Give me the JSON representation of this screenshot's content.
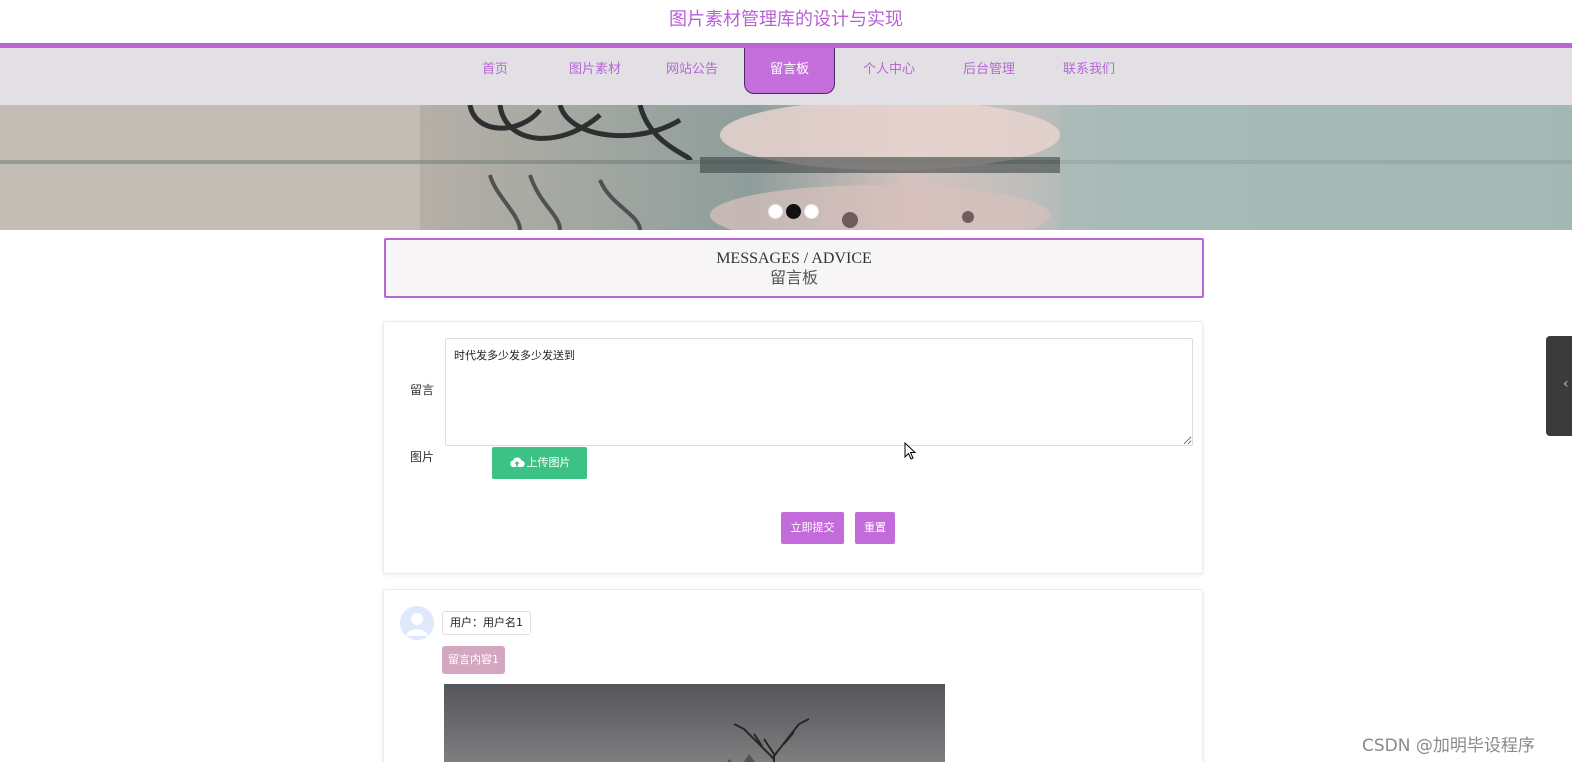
{
  "site": {
    "title": "图片素材管理库的设计与实现",
    "accent_color": "#bb66d6"
  },
  "nav": {
    "items": [
      {
        "label": "首页",
        "active": false
      },
      {
        "label": "图片素材",
        "active": false
      },
      {
        "label": "网站公告",
        "active": false
      },
      {
        "label": "留言板",
        "active": true
      },
      {
        "label": "个人中心",
        "active": false
      },
      {
        "label": "后台管理",
        "active": false
      },
      {
        "label": "联系我们",
        "active": false
      }
    ]
  },
  "banner": {
    "slide_count": 3,
    "active_slide": 2
  },
  "section": {
    "title_en": "MESSAGES / ADVICE",
    "title_cn": "留言板"
  },
  "form": {
    "message_label": "留言",
    "message_value": "时代发多少发多少发送到",
    "image_label": "图片",
    "upload_label": "上传图片",
    "upload_icon": "cloud-upload-icon",
    "submit_label": "立即提交",
    "reset_label": "重置"
  },
  "messages": [
    {
      "user": "用户：用户名1",
      "content": "留言内容1"
    }
  ],
  "watermark": "CSDN @加明毕设程序"
}
